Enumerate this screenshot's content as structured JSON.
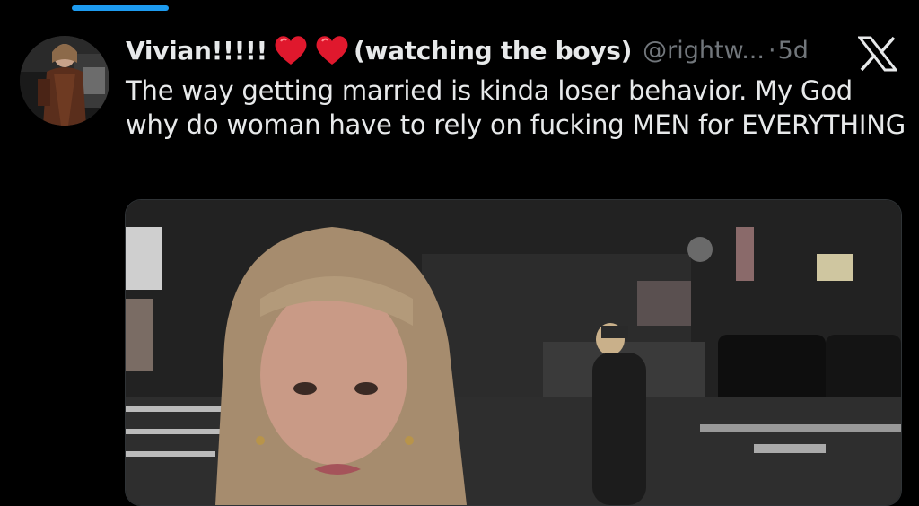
{
  "tweet": {
    "display_name": "Vivian!!!!!",
    "name_suffix": "(watching the boys)",
    "handle": "@rightw...",
    "separator": "·",
    "time": "5d",
    "text": "The way getting married is kinda loser behavior. My God why do woman have to rely on fucking MEN for EVERYTHING",
    "emoji": [
      "red-heart",
      "red-heart"
    ]
  },
  "media": {
    "type": "video-still",
    "description_icon": "photo"
  },
  "colors": {
    "background": "#000000",
    "text": "#e7e9ea",
    "muted": "#71767b",
    "accent": "#1d9bf0",
    "heart": "#e0182d"
  },
  "icons": {
    "platform_logo": "x-logo-icon"
  }
}
